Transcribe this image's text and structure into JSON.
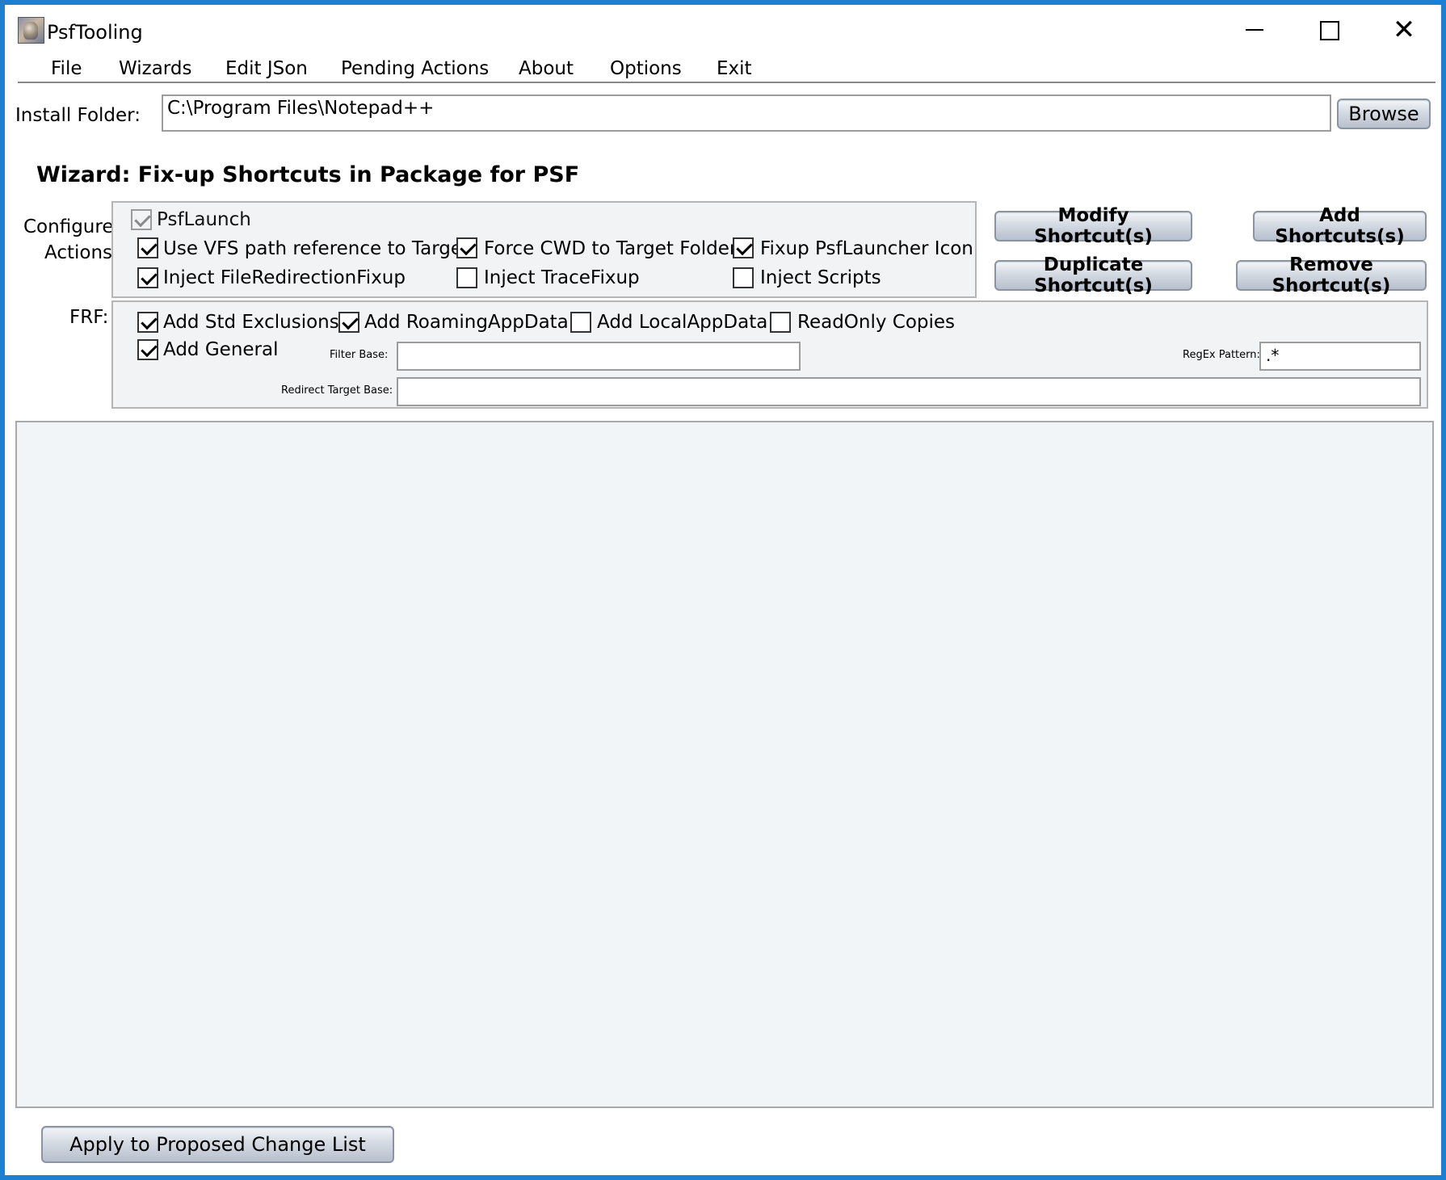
{
  "window": {
    "title": "PsfTooling",
    "controls": {
      "minimize": "",
      "maximize": "",
      "close": "✕"
    }
  },
  "menu": [
    "File",
    "Wizards",
    "Edit JSon",
    "Pending Actions",
    "About",
    "Options",
    "Exit"
  ],
  "install": {
    "label": "Install Folder:",
    "value": "C:\\Program Files\\Notepad++",
    "browse_label": "Browse"
  },
  "wizard": {
    "title": "Wizard: Fix-up Shortcuts in Package for PSF"
  },
  "configure": {
    "label_line1": "Configure:",
    "label_line2": "Actions:",
    "options": [
      {
        "label": "PsfLaunch",
        "checked": true,
        "disabled": true
      },
      {
        "label": "Use VFS path reference to Target",
        "checked": true
      },
      {
        "label": "Force CWD to Target Folder",
        "checked": true
      },
      {
        "label": "Fixup PsfLauncher Icon",
        "checked": true
      },
      {
        "label": "Inject FileRedirectionFixup",
        "checked": true
      },
      {
        "label": "Inject TraceFixup",
        "checked": false
      },
      {
        "label": "Inject Scripts",
        "checked": false
      }
    ]
  },
  "actions": {
    "modify": "Modify Shortcut(s)",
    "add": "Add Shortcuts(s)",
    "duplicate": "Duplicate Shortcut(s)",
    "remove": "Remove Shortcut(s)"
  },
  "frf": {
    "label": "FRF:",
    "options": [
      {
        "label": "Add Std Exclusions",
        "checked": true
      },
      {
        "label": "Add RoamingAppData",
        "checked": true
      },
      {
        "label": "Add LocalAppData",
        "checked": false
      },
      {
        "label": "ReadOnly Copies",
        "checked": false
      },
      {
        "label": "Add General",
        "checked": true
      }
    ],
    "filter_base_label": "Filter Base:",
    "filter_base_value": "",
    "regex_label": "RegEx Pattern:",
    "regex_value": ".*",
    "redirect_label": "Redirect Target Base:",
    "redirect_value": ""
  },
  "footer": {
    "apply_label": "Apply to Proposed Change List"
  }
}
